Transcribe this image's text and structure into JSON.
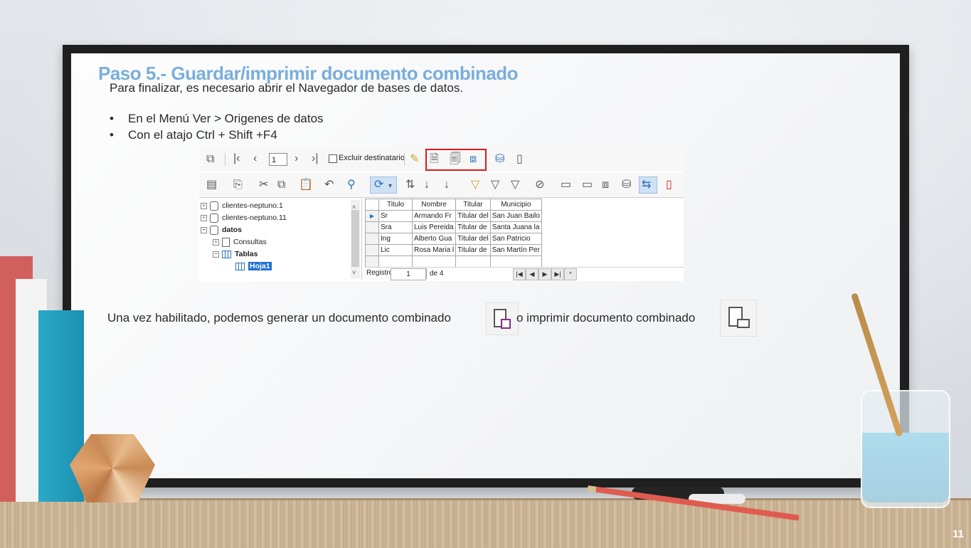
{
  "slide": {
    "title": "Paso 5.- Guardar/imprimir documento combinado",
    "intro": "Para finalizar, es necesario abrir el Navegador de bases de datos.",
    "bullets": [
      "En el Menú Ver > Origenes de datos",
      "Con el atajo  Ctrl + Shift +F4"
    ],
    "bottom_text_1": "Una vez habilitado, podemos generar un documento combinado",
    "bottom_text_2": "o imprimir  documento combinado",
    "page_number": "11"
  },
  "screenshot": {
    "record_field": "1",
    "exclude_label": "Excluir destinatario",
    "tree": {
      "items": [
        {
          "label": "clientes-neptuno.1",
          "type": "database",
          "expander": "+"
        },
        {
          "label": "clientes-neptuno.11",
          "type": "database",
          "expander": "+"
        },
        {
          "label": "datos",
          "type": "database",
          "expander": "−"
        },
        {
          "label": "Consultas",
          "type": "queries",
          "expander": "+"
        },
        {
          "label": "Tablas",
          "type": "tables",
          "expander": "−"
        },
        {
          "label": "Hoja1",
          "type": "table",
          "selected": true
        }
      ]
    },
    "grid": {
      "columns": [
        "Titulo",
        "Nombre",
        "Titular",
        "Municipio"
      ],
      "rows": [
        [
          "Sr",
          "Armando Fr",
          "Titular del",
          "San Juan Bailo"
        ],
        [
          "Sra",
          "Luis Pereida",
          "Titular de",
          "Santa Juana la"
        ],
        [
          "Ing",
          "Alberto Gua",
          "Titular del",
          "San Patricio"
        ],
        [
          "Lic",
          "Rosa Maria l",
          "Titular de",
          "San Martín Per"
        ]
      ]
    },
    "status": {
      "label": "Registro",
      "value": "1",
      "of": "de 4"
    }
  },
  "colors": {
    "title": "#79aedb",
    "highlight": "#e0191f",
    "selection": "#1e6fd9"
  }
}
